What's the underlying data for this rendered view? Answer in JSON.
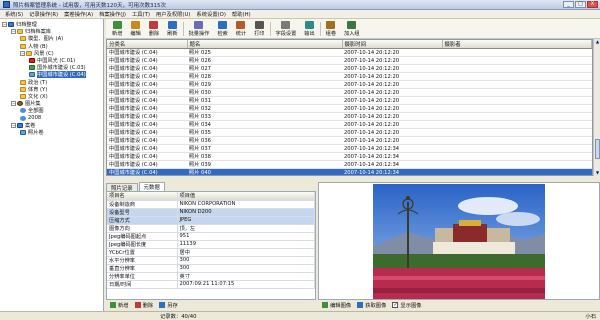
{
  "window": {
    "title": "照片档案管理系统 - 试用版，可用天数120天，可用次数315次",
    "buttons": [
      "_",
      "□",
      "X"
    ]
  },
  "menu": [
    "系统(S)",
    "记录操作(R)",
    "案卷操作(A)",
    "档案操作(J)",
    "工具(T)",
    "用户及权限(U)",
    "系统设置(O)",
    "帮助(H)"
  ],
  "tree": [
    {
      "label": "归档整理",
      "icon": "root-icon",
      "depth": 0,
      "expanded": true
    },
    {
      "label": "归档档案库",
      "icon": "folder-icon",
      "depth": 1,
      "expanded": true
    },
    {
      "label": "模型、图片 (A)",
      "icon": "folder-icon",
      "depth": 2
    },
    {
      "label": "人物 (B)",
      "icon": "folder-icon",
      "depth": 2
    },
    {
      "label": "风景 (C)",
      "icon": "folder-icon",
      "depth": 2,
      "expanded": true
    },
    {
      "label": "中国风光 (C.01)",
      "icon": "flag-icon",
      "depth": 3
    },
    {
      "label": "国外城市建设 (C.03)",
      "icon": "green-icon",
      "depth": 3
    },
    {
      "label": "中国城市建设 (C.04)",
      "icon": "img-icon",
      "depth": 3,
      "selected": true
    },
    {
      "label": "政治 (T)",
      "icon": "folder-icon",
      "depth": 2
    },
    {
      "label": "体育 (Y)",
      "icon": "folder-icon",
      "depth": 2
    },
    {
      "label": "文化 (X)",
      "icon": "folder-icon",
      "depth": 2
    },
    {
      "label": "图片集",
      "icon": "gear-icon",
      "depth": 1,
      "expanded": true
    },
    {
      "label": "全部图",
      "icon": "dot-icon",
      "depth": 2
    },
    {
      "label": "2008",
      "icon": "dot-icon",
      "depth": 2
    },
    {
      "label": "案卷",
      "icon": "root-icon",
      "depth": 1,
      "expanded": true
    },
    {
      "label": "照片卷",
      "icon": "img-icon",
      "depth": 2
    }
  ],
  "toolbar": [
    {
      "label": "新增",
      "icon": "add-icon",
      "color": "#3f8f3f"
    },
    {
      "label": "编辑",
      "icon": "edit-icon",
      "color": "#c98b1a"
    },
    {
      "label": "删除",
      "icon": "delete-icon",
      "color": "#c23a3a"
    },
    {
      "label": "刷新",
      "icon": "refresh-icon",
      "color": "#2c6fc0"
    },
    {
      "label": "批量操作",
      "icon": "batch-icon",
      "color": "#6b6bb5"
    },
    {
      "label": "检索",
      "icon": "search-icon",
      "color": "#2c6fc0"
    },
    {
      "label": "统计",
      "icon": "stats-icon",
      "color": "#b55a2a"
    },
    {
      "label": "打印",
      "icon": "print-icon",
      "color": "#555555"
    },
    {
      "label": "字段设置",
      "icon": "fields-icon",
      "color": "#7a7a7a"
    },
    {
      "label": "输出",
      "icon": "export-icon",
      "color": "#2f8a8a"
    },
    {
      "label": "组卷",
      "icon": "group-icon",
      "color": "#a07020"
    },
    {
      "label": "加入组",
      "icon": "join-icon",
      "color": "#3a7a3a"
    }
  ],
  "grid": {
    "columns": [
      "分类名",
      "题名",
      "摄影时间",
      "摄影者"
    ],
    "rows": [
      [
        "中国城市建设 (C.04)",
        "照片 025",
        "2007-10-14 20:12:20",
        ""
      ],
      [
        "中国城市建设 (C.04)",
        "照片 026",
        "2007-10-14 20:12:20",
        ""
      ],
      [
        "中国城市建设 (C.04)",
        "照片 027",
        "2007-10-14 20:12:20",
        ""
      ],
      [
        "中国城市建设 (C.04)",
        "照片 028",
        "2007-10-14 20:12:20",
        ""
      ],
      [
        "中国城市建设 (C.04)",
        "照片 029",
        "2007-10-14 20:12:20",
        ""
      ],
      [
        "中国城市建设 (C.04)",
        "照片 030",
        "2007-10-14 20:12:20",
        ""
      ],
      [
        "中国城市建设 (C.04)",
        "照片 031",
        "2007-10-14 20:12:20",
        ""
      ],
      [
        "中国城市建设 (C.04)",
        "照片 032",
        "2007-10-14 20:12:20",
        ""
      ],
      [
        "中国城市建设 (C.04)",
        "照片 033",
        "2007-10-14 20:12:20",
        ""
      ],
      [
        "中国城市建设 (C.04)",
        "照片 034",
        "2007-10-14 20:12:20",
        ""
      ],
      [
        "中国城市建设 (C.04)",
        "照片 035",
        "2007-10-14 20:12:20",
        ""
      ],
      [
        "中国城市建设 (C.04)",
        "照片 036",
        "2007-10-14 20:12:20",
        ""
      ],
      [
        "中国城市建设 (C.04)",
        "照片 037",
        "2007-10-14 20:12:34",
        ""
      ],
      [
        "中国城市建设 (C.04)",
        "照片 038",
        "2007-10-14 20:12:34",
        ""
      ],
      [
        "中国城市建设 (C.04)",
        "照片 039",
        "2007-10-14 20:12:34",
        ""
      ],
      [
        "中国城市建设 (C.04)",
        "照片 040",
        "2007-10-14 20:12:34",
        ""
      ]
    ],
    "selected_row": 15
  },
  "tabs": [
    "照片记录",
    "元数据"
  ],
  "active_tab": 1,
  "properties": {
    "header": [
      "项目名",
      "项目值"
    ],
    "rows": [
      [
        "设备制造商",
        "NIKON CORPORATION"
      ],
      [
        "设备型号",
        "NIKON D200"
      ],
      [
        "压缩方式",
        "JPEG"
      ],
      [
        "图像方向",
        "顶，左"
      ],
      [
        "Jpeg编码图起点",
        "951"
      ],
      [
        "Jpeg编码图长度",
        "11139"
      ],
      [
        "YCbCr位置",
        "居中"
      ],
      [
        "水平分辨率",
        "300"
      ],
      [
        "垂直分辨率",
        "300"
      ],
      [
        "分辨率单位",
        "英寸"
      ],
      [
        "日期/时间",
        "2007:09:21 11:07:15"
      ]
    ],
    "highlight_rows": [
      1,
      2
    ]
  },
  "prop_actions": [
    {
      "label": "新增",
      "icon": "add-icon"
    },
    {
      "label": "删除",
      "icon": "delete-icon"
    },
    {
      "label": "另存",
      "icon": "save-icon"
    }
  ],
  "image_actions": [
    {
      "label": "编辑图像",
      "icon": "edit-image-icon"
    },
    {
      "label": "获取图像",
      "icon": "acquire-image-icon"
    },
    {
      "label": "显示图像",
      "icon": "show-image-checkbox"
    }
  ],
  "status": {
    "records": "记录数：40/40",
    "right": "小石"
  }
}
